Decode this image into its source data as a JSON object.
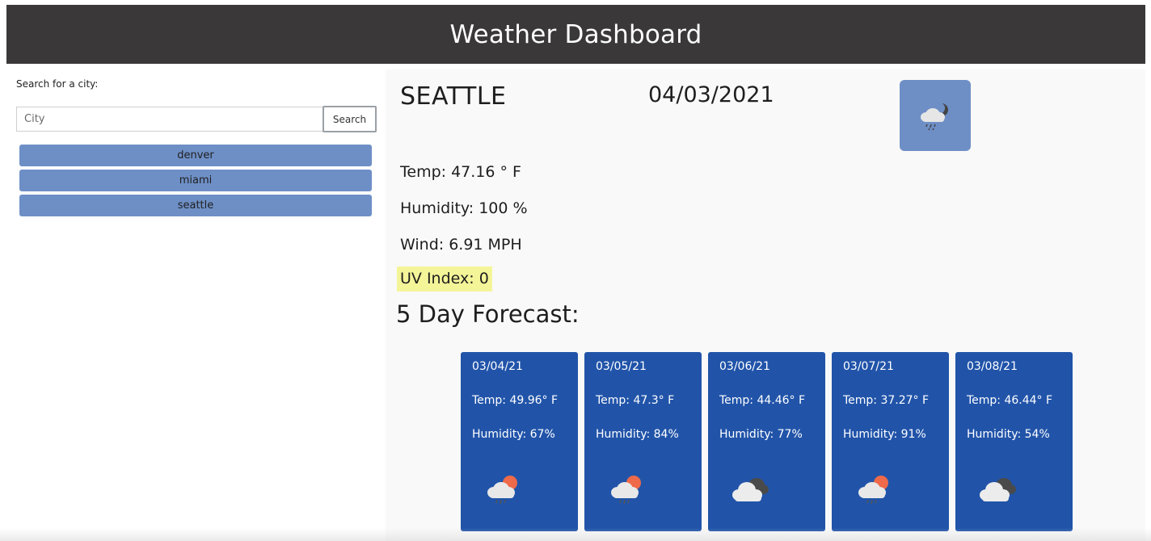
{
  "header": {
    "title": "Weather Dashboard"
  },
  "sidebar": {
    "search_label": "Search for a city:",
    "search_placeholder": "City",
    "search_value": "",
    "search_button": "Search",
    "history": [
      {
        "label": "denver"
      },
      {
        "label": "miami"
      },
      {
        "label": "seattle"
      }
    ]
  },
  "current": {
    "city": "SEATTLE",
    "date": "04/03/2021",
    "icon": "rain-cloud-night-icon",
    "temp": "Temp: 47.16 ° F",
    "humidity": "Humidity: 100 %",
    "wind": "Wind: 6.91 MPH",
    "uv": "UV Index: 0"
  },
  "forecast": {
    "title": "5 Day Forecast:",
    "days": [
      {
        "date": "03/04/21",
        "temp": "Temp: 49.96° F",
        "humidity": "Humidity: 67%",
        "icon": "rain-cloud-sun-icon"
      },
      {
        "date": "03/05/21",
        "temp": "Temp: 47.3° F",
        "humidity": "Humidity: 84%",
        "icon": "rain-cloud-sun-icon"
      },
      {
        "date": "03/06/21",
        "temp": "Temp: 44.46° F",
        "humidity": "Humidity: 77%",
        "icon": "broken-clouds-icon"
      },
      {
        "date": "03/07/21",
        "temp": "Temp: 37.27° F",
        "humidity": "Humidity: 91%",
        "icon": "rain-cloud-sun-icon"
      },
      {
        "date": "03/08/21",
        "temp": "Temp: 46.44° F",
        "humidity": "Humidity: 54%",
        "icon": "broken-clouds-icon"
      }
    ]
  },
  "colors": {
    "header_bg": "#3a3839",
    "history_bg": "#6e8fc6",
    "card_bg": "#2154a9",
    "uv_bg": "#f4f598"
  }
}
